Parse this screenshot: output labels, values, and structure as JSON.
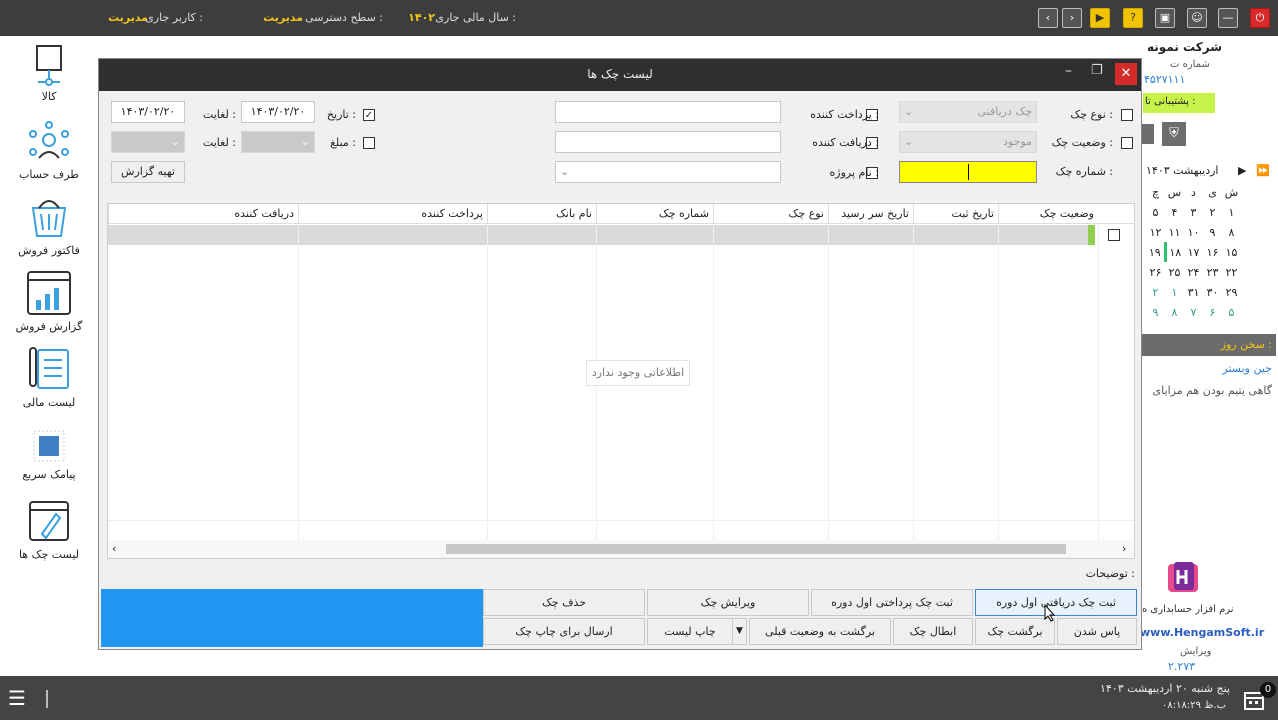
{
  "topbar": {
    "current_user_label": "کاربر جاری :",
    "current_user": "مدیریت",
    "access_label": "سطح دسترسی :",
    "access_level": "مدیریت",
    "fiscal_label": "سال مالی جاری :",
    "fiscal_year": "۱۴۰۲"
  },
  "left_nav": [
    {
      "label": "کالا",
      "icon": "box-icon"
    },
    {
      "label": "طرف حساب",
      "icon": "people-network-icon"
    },
    {
      "label": "فاکتور فروش",
      "icon": "basket-icon"
    },
    {
      "label": "گزارش فروش",
      "icon": "report-chart-icon"
    },
    {
      "label": "لیست مالی",
      "icon": "document-list-icon"
    },
    {
      "label": "پیامک سریع",
      "icon": "sms-icon"
    },
    {
      "label": "لیست چک ها",
      "icon": "check-list-icon"
    }
  ],
  "right_panel": {
    "company": "شرکت نمونه",
    "phone_label": "شماره ت",
    "phone": "۴۵۲۷۱۱۱",
    "support": "پشتیبانی تا : ",
    "calendar_month": "اردیبهشت ۱۴۰۳",
    "weekdays": [
      "ش",
      "ی",
      "د",
      "س",
      "چ"
    ],
    "weeks": [
      [
        "۱",
        "۲",
        "۳",
        "۴",
        "۵"
      ],
      [
        "۸",
        "۹",
        "۱۰",
        "۱۱",
        "۱۲"
      ],
      [
        "۱۵",
        "۱۶",
        "۱۷",
        "۱۸",
        "۱۹"
      ],
      [
        "۲۲",
        "۲۳",
        "۲۴",
        "۲۵",
        "۲۶"
      ],
      [
        "۲۹",
        "۳۰",
        "۳۱",
        "۱",
        "۲"
      ],
      [
        "۵",
        "۶",
        "۷",
        "۸",
        "۹"
      ]
    ],
    "quote_title": "سخن روز :",
    "quote_author": "جین وبستر",
    "quote_text": "گاهی یتیم بودن هم مزایای",
    "software_name": "نرم افزار حسابداری ه",
    "website": "www.HengamSoft.ir",
    "version_label": "ویرایش",
    "version": "۲.۲۷۳"
  },
  "dialog": {
    "title": "لیست چک ها",
    "filters": {
      "check_type_label": "نوع چک :",
      "check_type_value": "چک دریافتی",
      "check_status_label": "وضعیت چک :",
      "check_status_value": "موجود",
      "check_number_label": "شماره چک :",
      "payer_label": "پرداخت کننده :",
      "receiver_label": "دریافت کننده :",
      "project_label": "نام پروژه :",
      "date_label": "تاریخ :",
      "date_from": "۱۴۰۳/۰۲/۲۰",
      "to_label1": "لغایت :",
      "date_to": "۱۴۰۳/۰۲/۲۰",
      "amount_label": "مبلغ :",
      "to_label2": "لغایت :",
      "report_button": "تهیه گزارش"
    },
    "columns": [
      "وضعیت چک",
      "تاریخ ثبت",
      "تاریخ سر رسید",
      "نوع چک",
      "شماره چک",
      "نام بانک",
      "پرداخت کننده",
      "دریافت کننده"
    ],
    "empty_message": "اطلاعاتی وجود ندارد",
    "description_label": "توضیحات :",
    "buttons_row1": [
      "ثبت چک دریافتی اول دوره",
      "ثبت چک پرداختی اول دوره",
      "ویرایش چک",
      "حذف چک"
    ],
    "buttons_row2": [
      "پاس شدن",
      "برگشت چک",
      "ابطال چک",
      "برگشت به وضعیت قبلی",
      "چاپ لیست",
      "ارسال برای چاپ چک"
    ]
  },
  "bottombar": {
    "date_text": "پنج شنبه ۲۰ اردیبهشت ۱۴۰۳",
    "time_text": "۰۸:۱۸:۲۹ ب.ظ",
    "badge": "0"
  }
}
